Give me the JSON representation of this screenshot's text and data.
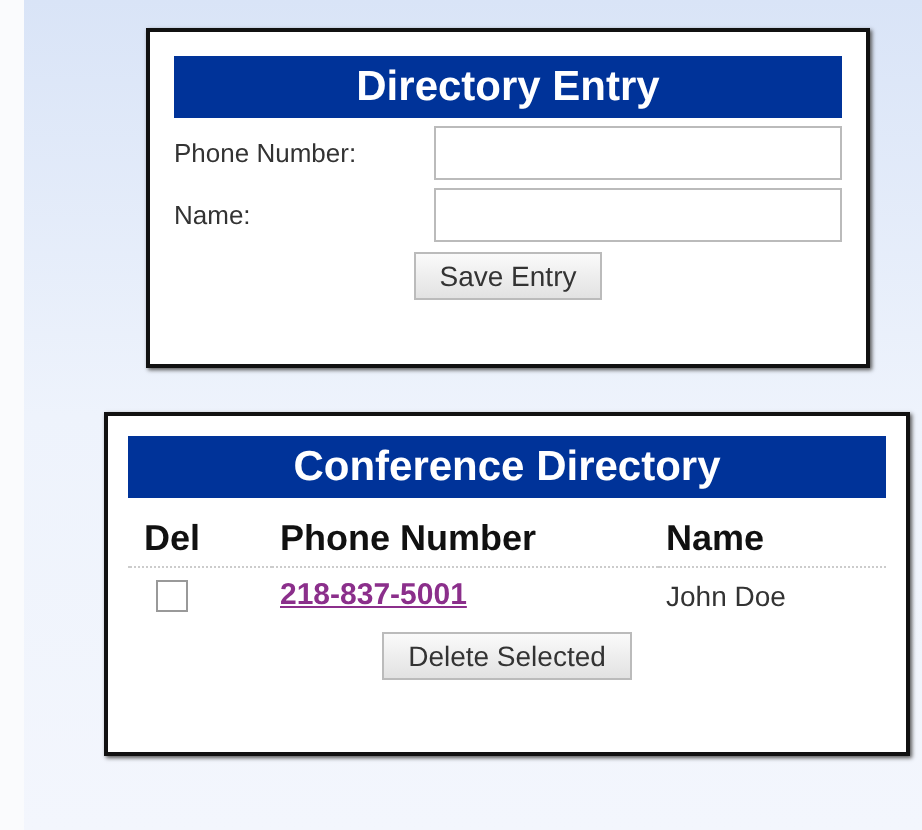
{
  "entry_form": {
    "title": "Directory Entry",
    "fields": [
      {
        "label": "Phone Number:"
      },
      {
        "label": "Name:"
      }
    ],
    "button": "Save Entry"
  },
  "directory": {
    "title": "Conference Directory",
    "columns": [
      "Del",
      "Phone Number",
      "Name"
    ],
    "rows": [
      {
        "checked": false,
        "phone": "218-837-5001",
        "name": "John Doe"
      }
    ],
    "button": "Delete Selected"
  }
}
